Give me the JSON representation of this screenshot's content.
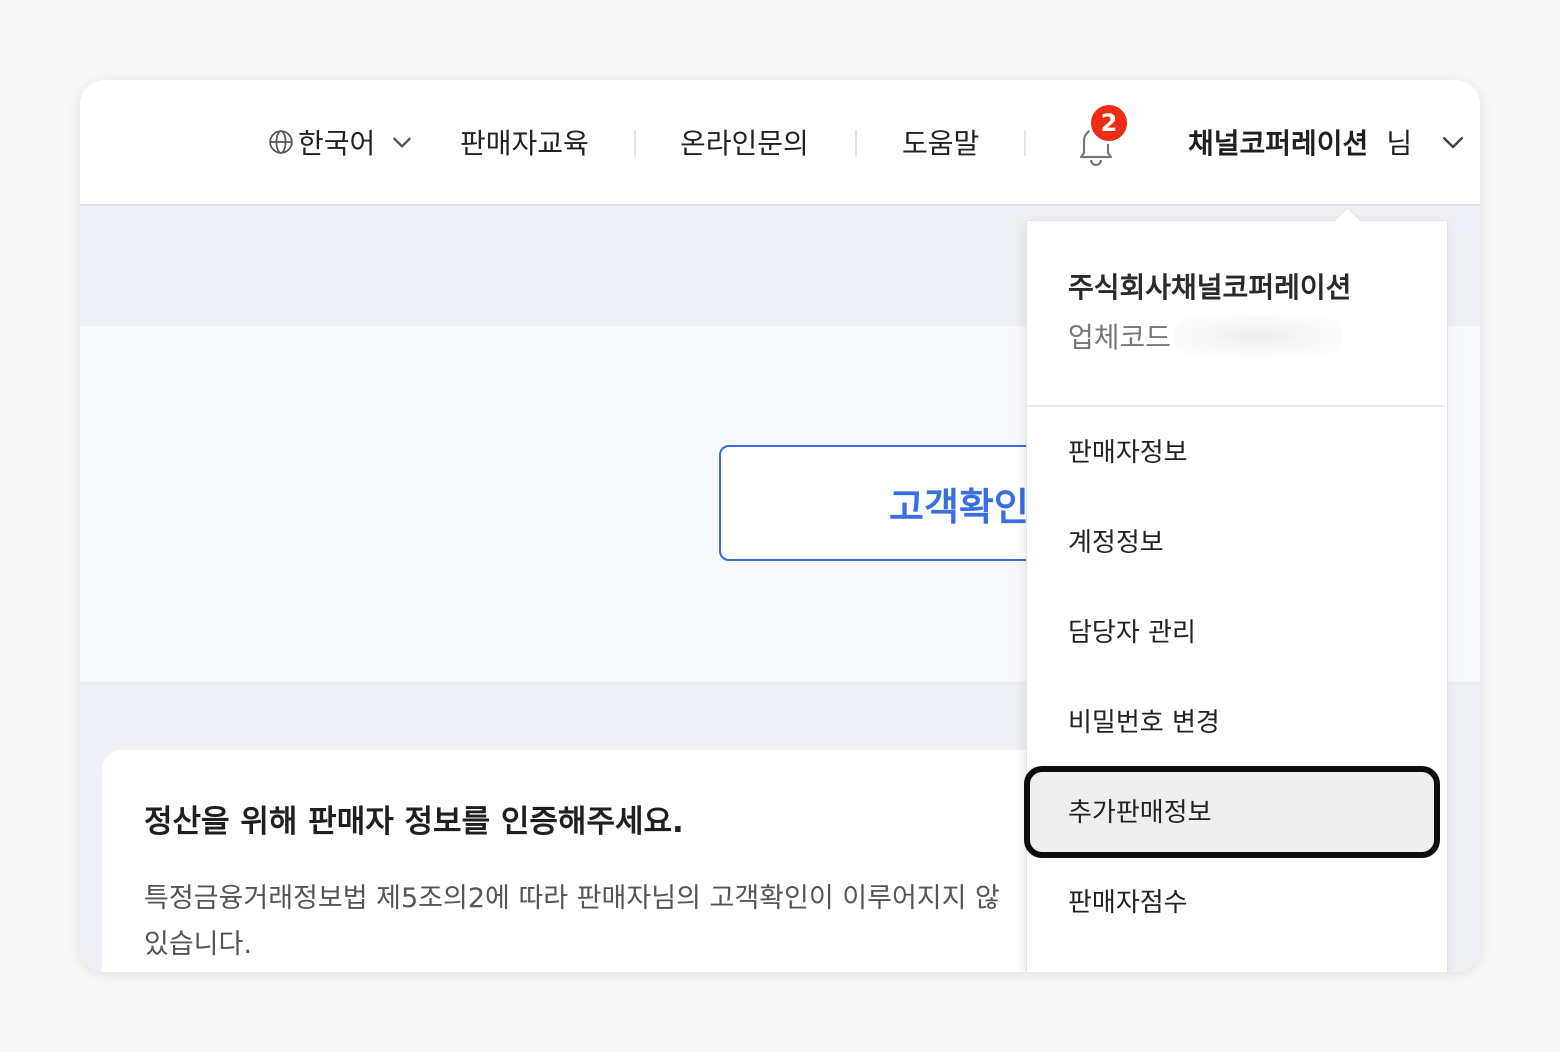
{
  "header": {
    "language": "한국어",
    "links": [
      "판매자교육",
      "온라인문의",
      "도움말"
    ],
    "notification_count": "2",
    "user_name": "채널코퍼레이션",
    "user_suffix": "님"
  },
  "main": {
    "confirm_button": "고객확인",
    "notice_title": "정산을 위해 판매자 정보를 인증해주세요.",
    "notice_line1": "특정금융거래정보법 제5조의2에 따라 판매자님의 고객확인이 이루어지지 않",
    "notice_line2": "있습니다."
  },
  "dropdown": {
    "company_name": "주식회사채널코퍼레이션",
    "code_label": "업체코드",
    "items": [
      "판매자정보",
      "계정정보",
      "담당자 관리",
      "비밀번호 변경",
      "추가판매정보",
      "판매자점수"
    ],
    "highlighted_item": "추가판매정보"
  },
  "colors": {
    "accent_blue": "#3a6fe0",
    "badge_red": "#ee2c16",
    "highlight_border": "#0d0d0d"
  }
}
